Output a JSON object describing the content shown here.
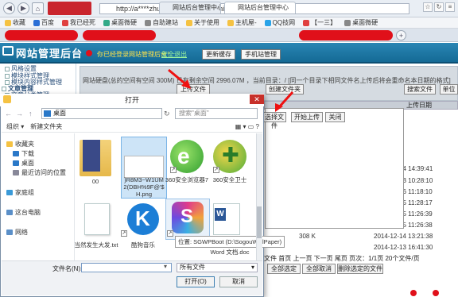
{
  "browser": {
    "address": "http://a****zhuolaoshi.cn/webAdmin/",
    "favorites": [
      "收藏",
      "百度",
      "我已经死",
      "桌面微硬",
      "自助建站",
      "关于使用",
      "主机屋-",
      "QQ技网",
      "【一三】",
      "桌面微硬"
    ],
    "tabs": [
      "网站后台管理中心",
      "网站后台管理中心"
    ]
  },
  "app": {
    "title": "网站管理后台",
    "welcome": "你已经登录网站管理后台！",
    "logout": "安全退出",
    "btn_cache": "更新缓存",
    "btn_mobile": "手机站管理"
  },
  "sidebar": {
    "items": [
      "风格设置",
      "模块样式管理",
      "模块内容样式管理",
      "文章管理",
      "文章分类管理"
    ]
  },
  "panel": {
    "info": "网站硬盘(总的空间有空间 300M) 已有剩余空间 2996.07M ，当前目录：/",
    "note": "[同一个目录下相同文件名上传后将会重命名本日期的格式]",
    "btn_upload": "上传文件",
    "btn_create": "创建文件夹",
    "btn_search": "搜索文件",
    "btn_single": "单位",
    "col_date": "上传日期"
  },
  "rows": [
    {
      "date": "2014-12-24 14:39:41"
    },
    {
      "date": "2014-12-23 10:28:10"
    },
    {
      "date": "2014-12-16 11:18:10"
    },
    {
      "date": "2014-12-15 11:28:17"
    },
    {
      "date": "2014-12-15 11:26:39"
    },
    {
      "date": "2014-12-15 11:26:38"
    },
    {
      "date": "2014-12-14 13:21:38",
      "size": "308 K"
    },
    {
      "date": "2014-12-13 16:41:30"
    }
  ],
  "upload_panel": {
    "choose": "选择文件",
    "start": "开始上传",
    "close": "关闭"
  },
  "footer_bar": {
    "paging": "文件  首页 上一页 下一页 尾页 页次：1/1页  20个文件/页",
    "select_all": "全部选定",
    "cancel_all": "全部取消",
    "delete_sel": "删除选定的文件"
  },
  "dialog": {
    "title": "打开",
    "path": "桌面",
    "search_placeholder": "搜索\"桌面\"",
    "organize": "组织 ▾",
    "new_folder": "新建文件夹",
    "nav": [
      "收藏夹",
      "下载",
      "桌面",
      "最近访问的位置",
      "家庭组",
      "这台电脑",
      "网络"
    ],
    "files": [
      {
        "name": "00",
        "icon": "folder-icon"
      },
      {
        "name": "}R8M3~W1UM\n2(DBH%9F@'$\nH.png",
        "icon": "image-icon"
      },
      {
        "name": "360安全浏览器7",
        "icon": "ie-icon"
      },
      {
        "name": "360安全卫士",
        "icon": "plus-icon"
      },
      {
        "name": "当然发生大发.txt",
        "icon": "text-icon"
      },
      {
        "name": "酷狗音乐",
        "icon": "kugou-icon"
      },
      {
        "name": "搜狗壁纸",
        "icon": "sogou-icon"
      },
      {
        "name": "新建 Microsoft\nWord 文档.doc",
        "icon": "word-icon"
      }
    ],
    "tooltip": "位置: SGWPBoot (D:\\SogouWallPaper)",
    "filename_label": "文件名(N):",
    "filetype": "所有文件",
    "open": "打开(O)",
    "cancel": "取消"
  }
}
